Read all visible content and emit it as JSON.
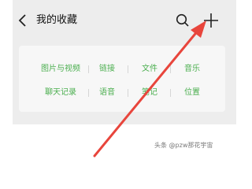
{
  "header": {
    "back_icon": "chevron-left-icon",
    "title": "我的收藏",
    "search_icon": "search-icon",
    "add_icon": "plus-icon"
  },
  "categories": [
    [
      "图片与视频",
      "链接",
      "文件",
      "音乐"
    ],
    [
      "聊天记录",
      "语音",
      "笔记",
      "位置"
    ]
  ],
  "annotation": {
    "icon": "red-arrow-icon",
    "color": "#e8453c",
    "points_to": "add-button"
  },
  "watermark": "头条 @pzw那花宇宙",
  "colors": {
    "background": "#ededed",
    "card": "#f7f7f7",
    "category_text": "#4caf50",
    "title_text": "#111111"
  }
}
